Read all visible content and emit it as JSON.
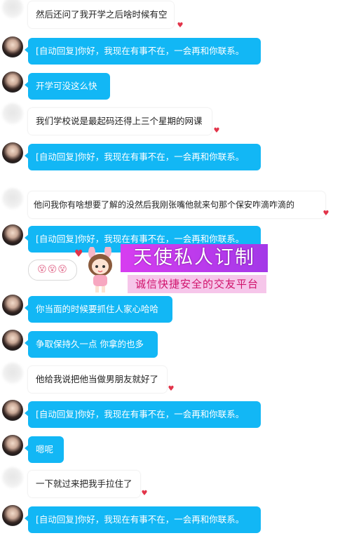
{
  "messages": [
    {
      "side": "in",
      "text": "然后还问了我开学之后啥时候有空"
    },
    {
      "side": "out",
      "text": "[自动回复]你好，我现在有事不在，一会再和你联系。"
    },
    {
      "side": "out",
      "text": "开学可没这么快"
    },
    {
      "side": "in",
      "text": "我们学校说是最起码还得上三个星期的网课"
    },
    {
      "side": "out",
      "text": "[自动回复]你好，我现在有事不在，一会再和你联系。"
    },
    {
      "side": "in",
      "text": "他问我你有啥想要了解的没然后我刚张嘴他就来句那个保安咋滴咋滴的"
    },
    {
      "side": "out",
      "text": "[自动回复]你好，我现在有事不在，一会再和你联系。"
    },
    {
      "side": "out",
      "text": "你当面的时候要抓住人家心哈哈"
    },
    {
      "side": "out",
      "text": "争取保持久一点 你拿的也多"
    },
    {
      "side": "in",
      "text": "他给我说把他当做男朋友就好了"
    },
    {
      "side": "out",
      "text": "[自动回复]你好，我现在有事不在，一会再和你联系。"
    },
    {
      "side": "out",
      "text": "嗯呢"
    },
    {
      "side": "in",
      "text": "一下就过来把我手拉住了"
    },
    {
      "side": "out",
      "text": "[自动回复]你好，我现在有事不在，一会再和你联系。"
    }
  ],
  "watermark": {
    "title": "天使私人订制",
    "subtitle": "诚信快捷安全的交友平台",
    "sticker": "😵😵😵"
  },
  "colors": {
    "outgoing_bubble": "#12b7f5",
    "incoming_bubble": "#ffffff",
    "watermark_title_bg": "#c93ced",
    "watermark_sub_text": "#d0136c"
  },
  "icons": {
    "bubble_end": "heart-icon",
    "avatar_other": "blurred-avatar",
    "avatar_self": "user-avatar"
  }
}
